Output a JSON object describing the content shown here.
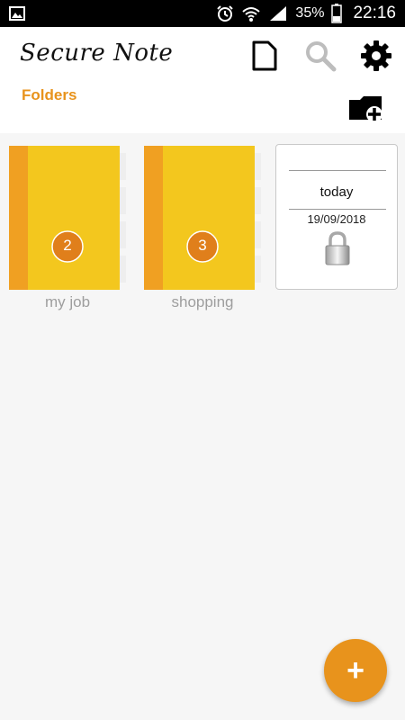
{
  "status_bar": {
    "battery_percent": "35%",
    "time": "22:16",
    "left_icon": "image-icon",
    "icons": [
      "alarm-icon",
      "wifi-icon",
      "signal-icon",
      "battery-icon"
    ]
  },
  "app": {
    "title": "Secure Note",
    "icons": [
      "new-note-icon",
      "search-icon",
      "gear-icon",
      "add-folder-icon"
    ],
    "accent": "#e8931c"
  },
  "folders_label": "Folders",
  "folders": [
    {
      "name": "my job",
      "count": "2"
    },
    {
      "name": "shopping",
      "count": "3"
    }
  ],
  "notes": [
    {
      "title": "today",
      "date": "19/09/2018",
      "locked": true,
      "icon": "lock-icon"
    }
  ],
  "fab": {
    "label": "+",
    "icon": "add-icon"
  }
}
